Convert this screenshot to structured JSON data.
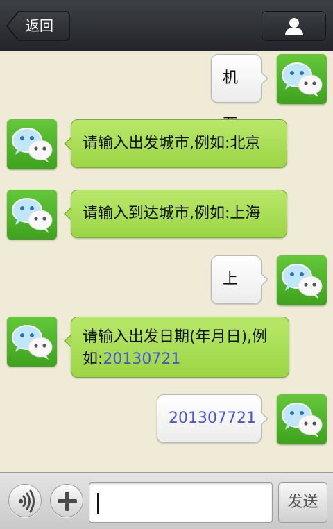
{
  "header": {
    "back_label": "返回",
    "contact_icon": "person-icon"
  },
  "messages": [
    {
      "side": "right",
      "lines": [
        [
          "机票"
        ]
      ]
    },
    {
      "side": "left",
      "lines": [
        [
          "请输入出发城市,例如:北京"
        ]
      ]
    },
    {
      "side": "left",
      "lines": [
        [
          "请输入到达城市,例如:上海"
        ]
      ]
    },
    {
      "side": "right",
      "lines": [
        [
          "上海"
        ]
      ]
    },
    {
      "side": "left",
      "lines": [
        [
          "请输入出发日期(年月日),例"
        ],
        [
          "如:",
          "20130721"
        ]
      ]
    },
    {
      "side": "right",
      "lines": [
        [
          "",
          "201307721"
        ]
      ]
    }
  ],
  "toolbar": {
    "voice_icon": "voice-icon",
    "add_icon": "plus-icon",
    "input_value": "",
    "send_label": "发送"
  },
  "colors": {
    "background": "#efebd6",
    "header": "#2f3136",
    "bubble_green": "#a8dc52",
    "bubble_white": "#f6f6f6",
    "link_blue": "#4a55d8"
  }
}
